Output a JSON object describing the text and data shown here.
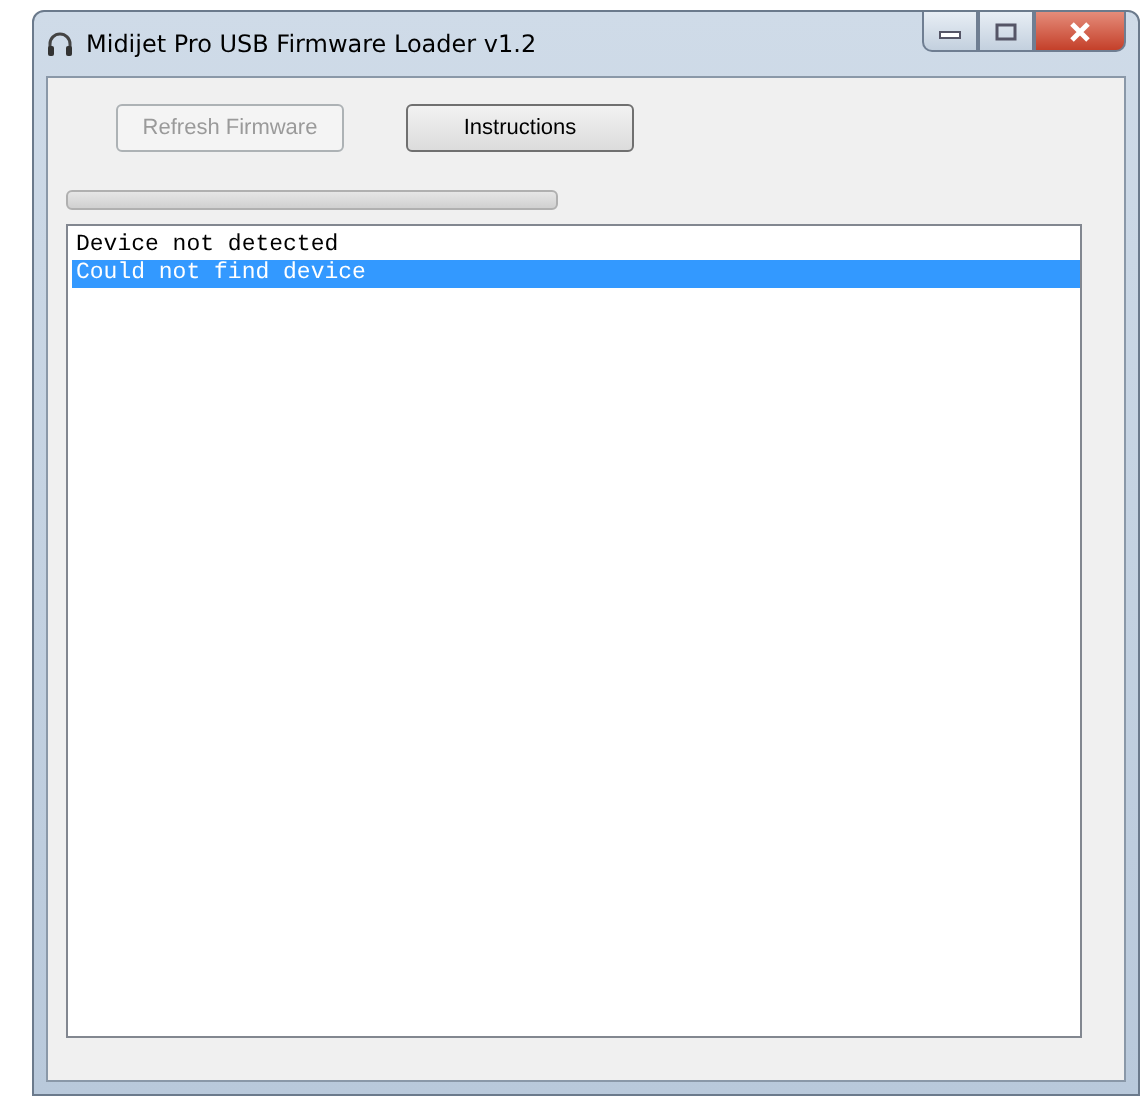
{
  "window": {
    "title": "Midijet Pro USB Firmware Loader v1.2"
  },
  "buttons": [
    {
      "label": "Refresh Firmware",
      "disabled": true
    },
    {
      "label": "Instructions",
      "disabled": false
    }
  ],
  "progress": {
    "level": 0
  },
  "log": [
    {
      "text": "Device not detected",
      "selected": false
    },
    {
      "text": "Could not find device",
      "selected": true
    }
  ]
}
